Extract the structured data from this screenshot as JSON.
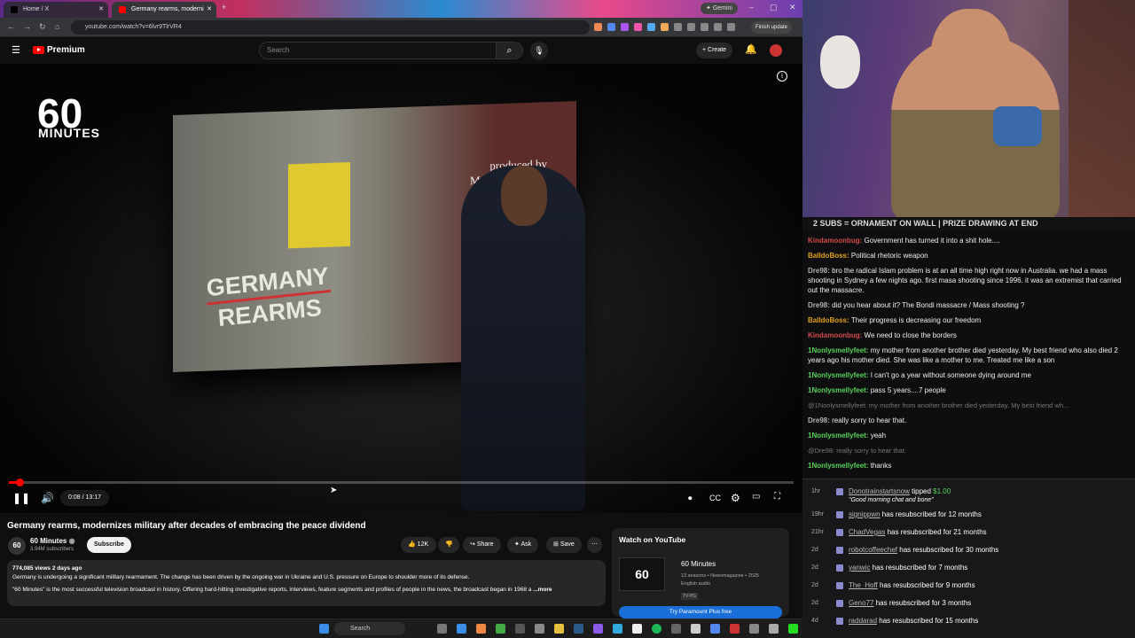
{
  "browser": {
    "tabs": [
      {
        "label": "Home / X"
      },
      {
        "label": "Germany rearms, moderni"
      }
    ],
    "gemini_label": "Gemini",
    "url": "youtube.com/watch?v=6lvr9TlrVR4",
    "finish_update": "Finish update"
  },
  "youtube": {
    "logo_text": "Premium",
    "search_placeholder": "Search",
    "create_label": "Create",
    "video": {
      "logo_number": "60",
      "logo_word": "MINUTES",
      "overlay_title_1": "GERMANY",
      "overlay_title_2": "REARMS",
      "produced_by_1": "produced by",
      "produced_by_2": "Marc Lieberman",
      "time": "0:08 / 13:17",
      "progress": 0.01
    },
    "title": "Germany rearms, modernizes military after decades of embracing the peace dividend",
    "channel": {
      "logo": "60",
      "name": "60 Minutes",
      "subs": "3.94M subscribers",
      "subscribe_label": "Subscribe"
    },
    "actions": {
      "likes": "12K",
      "share": "Share",
      "ask": "Ask",
      "save": "Save"
    },
    "description": {
      "meta": "774,085 views  2 days ago",
      "line1": "Germany is undergoing a significant military rearmament. The change has been driven by the ongoing war in Ukraine and U.S. pressure on Europe to shoulder more of its defense.",
      "line2": "\"60 Minutes\" is the most successful television broadcast in history. Offering hard-hitting investigative reports, interviews, feature segments and profiles of people in the news, the broadcast began in 1968 a",
      "more": "...more"
    },
    "watch_panel": {
      "heading": "Watch on YouTube",
      "show": "60 Minutes",
      "meta1": "13 seasons • Newsmagazine • 2025",
      "meta2": "English audio",
      "rating": "TV-PG",
      "cta": "Try Paramount Plus free"
    }
  },
  "taskbar": {
    "search": "Search"
  },
  "stream": {
    "banner": "2 SUBS = ORNAMENT ON WALL | PRIZE DRAWING AT END",
    "chat": [
      {
        "user": "Kindamoonbug",
        "color": "#d14a4a",
        "text": "Government has turned it into a shit hole...."
      },
      {
        "user": "BalldoBoss",
        "color": "#e0a020",
        "text": "Political rhetoric weapon"
      },
      {
        "user": "Dre98",
        "color": "#b0b0b0",
        "text": "bro the radical Islam problem is at an all time high right now in Australia. we had a mass shooting in Sydney a few nights ago. first masa shooting since 1996. it was an extremist that carried out the massacre."
      },
      {
        "user": "Dre98",
        "color": "#b0b0b0",
        "text": "did you hear about it? The Bondi massacre / Mass shooting ?"
      },
      {
        "user": "BalldoBoss",
        "color": "#e0a020",
        "text": "Their progress is decreasing our freedom"
      },
      {
        "user": "Kindamoonbug",
        "color": "#d14a4a",
        "text": "We need to close the borders"
      },
      {
        "user": "1Nonlysmellyfeet",
        "color": "#5ad05a",
        "text": "my mother from another brother died yesterday. My best friend who also died 2 years ago his mother died. She was like a mother to me. Treated me like a son"
      },
      {
        "user": "1Nonlysmellyfeet",
        "color": "#5ad05a",
        "text": "I can't go a year without someone dying around me"
      },
      {
        "user": "1Nonlysmellyfeet",
        "color": "#5ad05a",
        "text": "pass 5 years....7 people"
      }
    ],
    "reply1": "@1Nonlysmellyfeet: my mother from another brother died yesterday. My best friend wh...",
    "chat2": [
      {
        "user": "Dre98",
        "color": "#b0b0b0",
        "text": "really sorry to hear that."
      },
      {
        "user": "1Nonlysmellyfeet",
        "color": "#5ad05a",
        "text": "yeah"
      }
    ],
    "reply2": "@Dre98: really sorry to hear that.",
    "chat3": [
      {
        "user": "1Nonlysmellyfeet",
        "color": "#5ad05a",
        "text": "thanks"
      }
    ],
    "events": [
      {
        "time": "1hr",
        "name": "Donotrainstartsnow",
        "text": "tipped",
        "amount": "$1.00",
        "quote": "\"Good morning chat and bone\""
      },
      {
        "time": "19hr",
        "name": "signippwn",
        "text": "has resubscribed for 12 months"
      },
      {
        "time": "21hr",
        "name": "ChadVegas",
        "text": "has resubscribed for 21 months"
      },
      {
        "time": "2d",
        "name": "robotcoffeechef",
        "text": "has resubscribed for 30 months"
      },
      {
        "time": "2d",
        "name": "yanwic",
        "text": "has resubscribed for 7 months"
      },
      {
        "time": "2d",
        "name": "The_Hoff",
        "text": "has resubscribed for 9 months"
      },
      {
        "time": "2d",
        "name": "Geno77",
        "text": "has resubscribed for 3 months"
      },
      {
        "time": "4d",
        "name": "raddarad",
        "text": "has resubscribed for 15 months"
      }
    ]
  }
}
